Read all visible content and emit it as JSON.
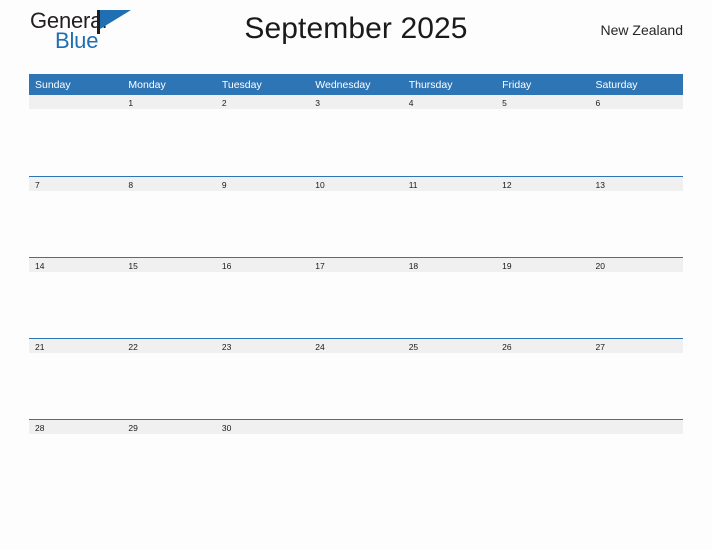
{
  "brand": {
    "name_part1": "General",
    "name_part2": "Blue",
    "flag_icon": "flag-triangle-icon"
  },
  "header": {
    "title": "September 2025",
    "locale": "New Zealand"
  },
  "calendar": {
    "day_headers": [
      "Sunday",
      "Monday",
      "Tuesday",
      "Wednesday",
      "Thursday",
      "Friday",
      "Saturday"
    ],
    "weeks": [
      [
        "",
        "1",
        "2",
        "3",
        "4",
        "5",
        "6"
      ],
      [
        "7",
        "8",
        "9",
        "10",
        "11",
        "12",
        "13"
      ],
      [
        "14",
        "15",
        "16",
        "17",
        "18",
        "19",
        "20"
      ],
      [
        "21",
        "22",
        "23",
        "24",
        "25",
        "26",
        "27"
      ],
      [
        "28",
        "29",
        "30",
        "",
        "",
        "",
        ""
      ]
    ]
  },
  "colors": {
    "header_blue": "#2e75b6",
    "band_gray": "#f0f0f0",
    "brand_blue": "#1f6fb2",
    "page_background": "#fdfdfd",
    "text_dark": "#1a1a1a"
  }
}
